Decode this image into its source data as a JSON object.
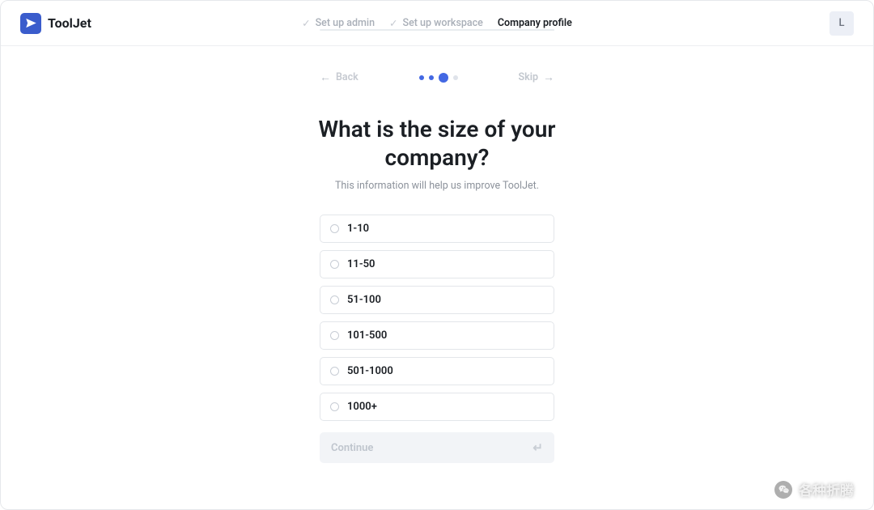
{
  "brand": {
    "name": "ToolJet"
  },
  "header": {
    "steps": [
      {
        "label": "Set up admin",
        "done": true
      },
      {
        "label": "Set up workspace",
        "done": true
      },
      {
        "label": "Company profile",
        "active": true
      }
    ],
    "avatar_initial": "L"
  },
  "wizard": {
    "back_label": "Back",
    "skip_label": "Skip",
    "progress": {
      "total": 4,
      "current": 3
    },
    "title": "What is the size of your company?",
    "subtitle": "This information will help us improve ToolJet.",
    "options": [
      {
        "label": "1-10"
      },
      {
        "label": "11-50"
      },
      {
        "label": "51-100"
      },
      {
        "label": "101-500"
      },
      {
        "label": "501-1000"
      },
      {
        "label": "1000+"
      }
    ],
    "continue_label": "Continue"
  },
  "overlay": {
    "text": "各种折腾"
  }
}
